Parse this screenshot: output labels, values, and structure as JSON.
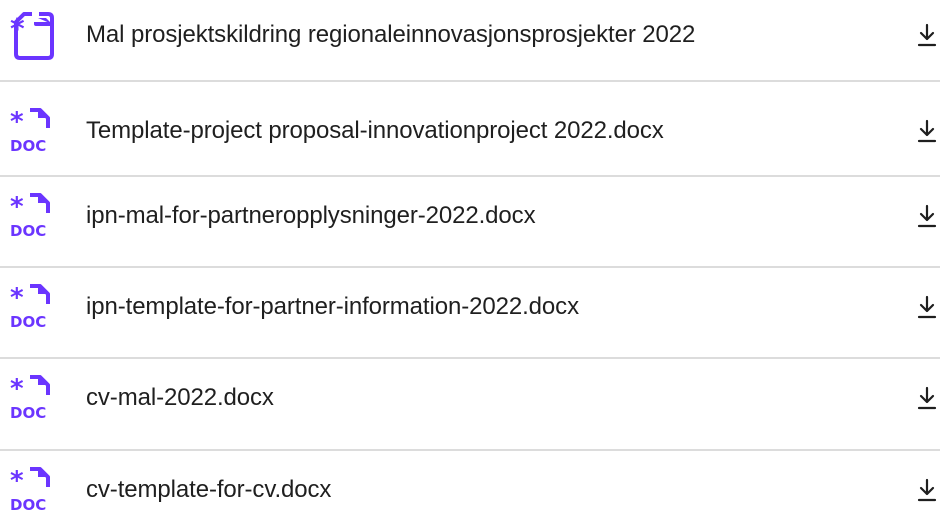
{
  "colors": {
    "icon": "#6b35ff",
    "text": "#1f1f1f",
    "divider": "#dcdcdc"
  },
  "files": [
    {
      "name": "Mal prosjektskildring regionaleinnovasjonsprosjekter 2022",
      "icon": "file-icon",
      "badge": ""
    },
    {
      "name": "Template-project proposal-innovationproject 2022.docx",
      "icon": "doc-file-icon",
      "badge": "DOC"
    },
    {
      "name": "ipn-mal-for-partneropplysninger-2022.docx",
      "icon": "doc-file-icon",
      "badge": "DOC"
    },
    {
      "name": "ipn-template-for-partner-information-2022.docx",
      "icon": "doc-file-icon",
      "badge": "DOC"
    },
    {
      "name": "cv-mal-2022.docx",
      "icon": "doc-file-icon",
      "badge": "DOC"
    },
    {
      "name": "cv-template-for-cv.docx",
      "icon": "doc-file-icon",
      "badge": "DOC"
    }
  ],
  "download_icon": "download-icon"
}
